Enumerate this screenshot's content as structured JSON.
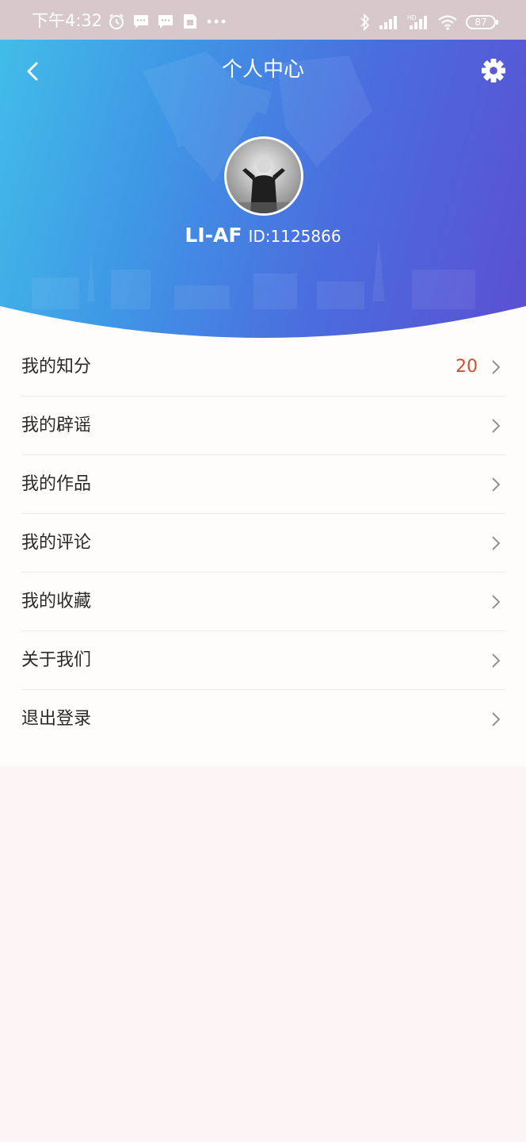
{
  "status_bar": {
    "time": "下午4:32",
    "left_icons": [
      "alarm-icon",
      "message-icon",
      "message-icon",
      "sim-icon",
      "more-dots-icon"
    ],
    "right_icons": [
      "bluetooth-icon",
      "signal-icon",
      "hd-signal-icon",
      "wifi-icon"
    ],
    "battery": "87"
  },
  "header": {
    "title": "个人中心",
    "back_icon": "chevron-left-icon",
    "settings_icon": "gear-icon"
  },
  "profile": {
    "username": "LI-AF",
    "user_id": "ID:1125866",
    "avatar": "avatar-photo"
  },
  "menu": {
    "items": [
      {
        "label": "我的知分",
        "value": "20"
      },
      {
        "label": "我的辟谣",
        "value": ""
      },
      {
        "label": "我的作品",
        "value": ""
      },
      {
        "label": "我的评论",
        "value": ""
      },
      {
        "label": "我的收藏",
        "value": ""
      },
      {
        "label": "关于我们",
        "value": ""
      },
      {
        "label": "退出登录",
        "value": ""
      }
    ],
    "chevron_icon": "chevron-right-icon"
  },
  "colors": {
    "hero_gradient_start": "#41bde8",
    "hero_gradient_end": "#5b4fd2",
    "accent_value": "#d0502e",
    "page_background": "#fdf5f5",
    "status_bar": "#d7c9cb"
  }
}
